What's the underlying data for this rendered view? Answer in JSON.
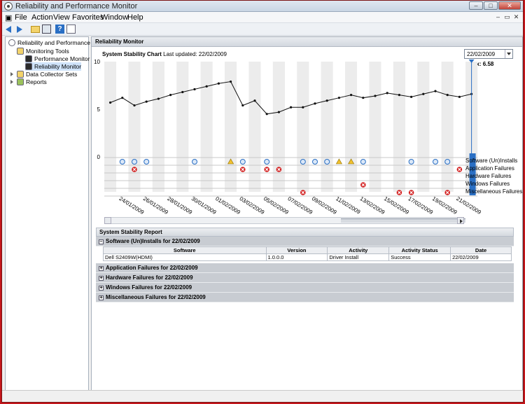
{
  "window": {
    "title": "Reliability and Performance Monitor"
  },
  "menu": [
    "File",
    "Action",
    "View",
    "Favorites",
    "Window",
    "Help"
  ],
  "tree": {
    "root": "Reliability and Performance",
    "monitoring_tools": "Monitoring Tools",
    "performance_monitor": "Performance Monitor",
    "reliability_monitor": "Reliability Monitor",
    "data_collector_sets": "Data Collector Sets",
    "reports": "Reports"
  },
  "main": {
    "header": "Reliability Monitor",
    "chart_title": "System Stability Chart",
    "last_updated": "Last updated: 22/02/2009",
    "date_select": "22/02/2009",
    "index": "Index: 6.58"
  },
  "chart_data": {
    "type": "line",
    "title": "System Stability Chart",
    "ylim": [
      0,
      10
    ],
    "y_ticks": [
      "10",
      "5",
      "0"
    ],
    "x_tick_labels": [
      "24/01/2009",
      "26/01/2009",
      "28/01/2009",
      "30/01/2009",
      "01/02/2009",
      "03/02/2009",
      "05/02/2009",
      "07/02/2009",
      "09/02/2009",
      "11/02/2009",
      "13/02/2009",
      "15/02/2009",
      "17/02/2009",
      "19/02/2009",
      "21/02/2009"
    ],
    "series": [
      {
        "values": [
          5.7,
          6.2,
          5.4,
          5.8,
          6.1,
          6.5,
          6.8,
          7.1,
          7.4,
          7.7,
          7.9,
          5.4,
          5.9,
          4.5,
          4.7,
          5.2,
          5.2,
          5.6,
          5.9,
          6.2,
          6.5,
          6.2,
          6.4,
          6.7,
          6.5,
          6.3,
          6.6,
          6.9,
          6.5,
          6.3,
          6.6
        ]
      }
    ],
    "event_rows": [
      "Software (Un)Installs",
      "Application Failures",
      "Hardware Failures",
      "Windows Failures",
      "Miscellaneous Failures"
    ],
    "events": {
      "installs": [
        1,
        2,
        3,
        7,
        11,
        13,
        16,
        17,
        18,
        21,
        25,
        27,
        28
      ],
      "install_warnings": [
        10,
        19,
        20
      ],
      "app_failures": [
        2,
        11,
        13,
        14,
        29
      ],
      "windows_failures": [
        21
      ],
      "misc_failures": [
        16,
        24,
        25,
        28
      ]
    },
    "selected_index": 30
  },
  "report": {
    "title": "System Stability Report",
    "software_section": "Software (Un)Installs for 22/02/2009",
    "columns": [
      "Software",
      "Version",
      "Activity",
      "Activity Status",
      "Date"
    ],
    "rows": [
      [
        "Dell S2409W(HDMI)",
        "1.0.0.0",
        "Driver Install",
        "Success",
        "22/02/2009"
      ]
    ],
    "collapsed_sections": [
      "Application Failures for 22/02/2009",
      "Hardware Failures for 22/02/2009",
      "Windows Failures for 22/02/2009",
      "Miscellaneous Failures for 22/02/2009"
    ]
  },
  "colors": {
    "chrome_red": "#c4161c",
    "install_blue": "#2a6fc4",
    "failure_red": "#d32020",
    "warning_yellow": "#f2c12e"
  }
}
